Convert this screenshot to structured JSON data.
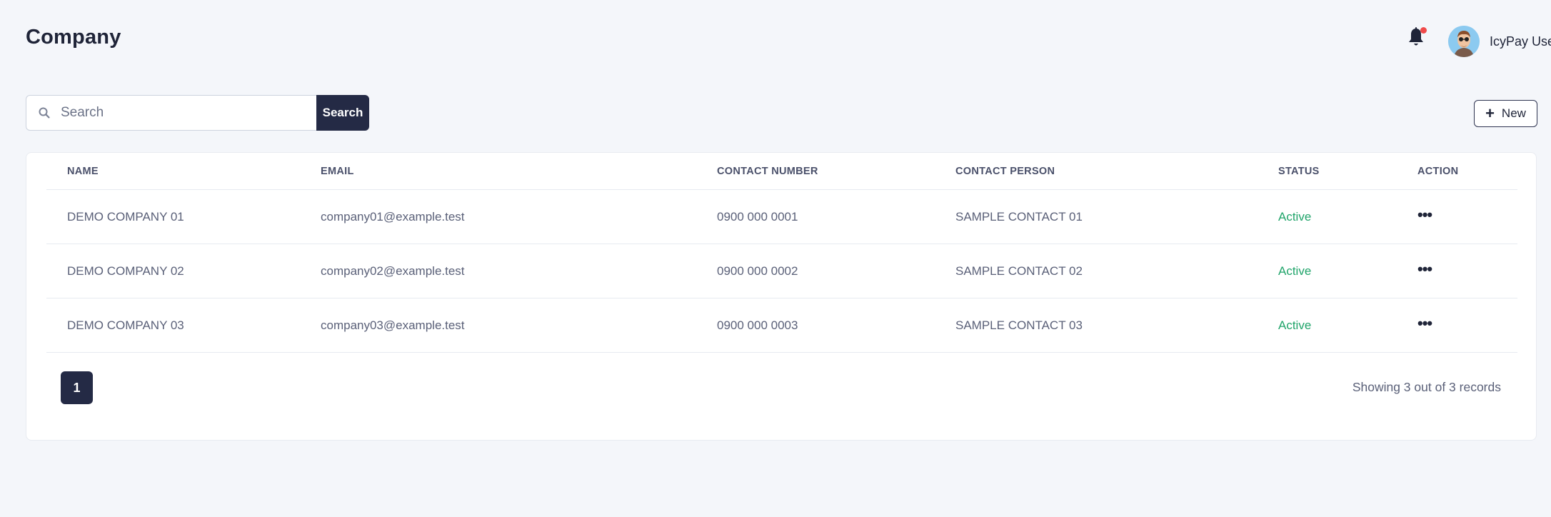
{
  "header": {
    "title": "Company",
    "user_name": "IcyPay User"
  },
  "search": {
    "placeholder": "Search",
    "button_label": "Search"
  },
  "toolbar": {
    "new_label": "New"
  },
  "table": {
    "columns": [
      "NAME",
      "EMAIL",
      "CONTACT NUMBER",
      "CONTACT PERSON",
      "STATUS",
      "ACTION"
    ],
    "rows": [
      {
        "name": "DEMO COMPANY 01",
        "email": "company01@example.test",
        "contact_number": "0900 000 0001",
        "contact_person": "SAMPLE CONTACT 01",
        "status": "Active",
        "action": "•••"
      },
      {
        "name": "DEMO COMPANY 02",
        "email": "company02@example.test",
        "contact_number": "0900 000 0002",
        "contact_person": "SAMPLE CONTACT 02",
        "status": "Active",
        "action": "•••"
      },
      {
        "name": "DEMO COMPANY 03",
        "email": "company03@example.test",
        "contact_number": "0900 000 0003",
        "contact_person": "SAMPLE CONTACT 03",
        "status": "Active",
        "action": "•••"
      }
    ]
  },
  "pagination": {
    "current_page": "1",
    "records_text": "Showing 3 out of 3 records"
  },
  "icons": {
    "bell": "bell-icon",
    "search": "search-icon",
    "plus": "plus-icon",
    "more": "more-horizontal-icon"
  },
  "colors": {
    "primary": "#242a45",
    "status_active": "#20a46a",
    "notification_dot": "#f04a4a",
    "background": "#f4f6fa"
  }
}
